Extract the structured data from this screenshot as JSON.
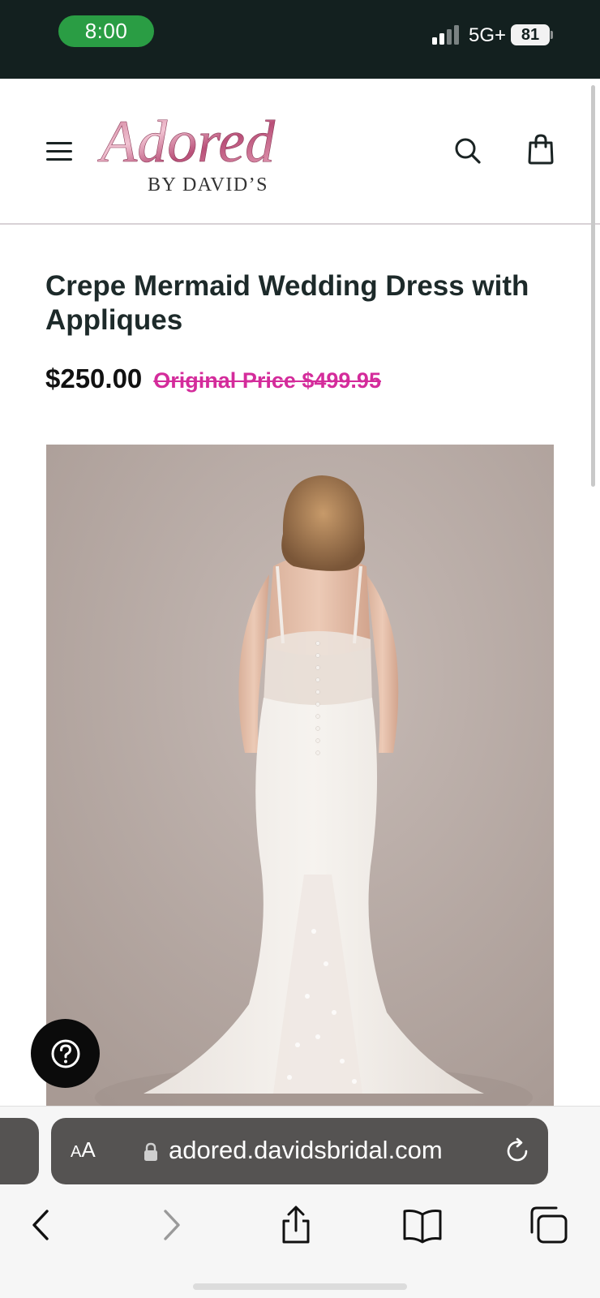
{
  "status_bar": {
    "time": "8:00",
    "network": "5G+",
    "battery": "81"
  },
  "header": {
    "logo_script": "Adored",
    "logo_subtitle": "BY DAVID’S",
    "icons": [
      "menu-icon",
      "search-icon",
      "shopping-bag-icon"
    ]
  },
  "product": {
    "title": "Crepe Mermaid Wedding Dress with Appliques",
    "sale_price": "$250.00",
    "original_price": "Original Price $499.95"
  },
  "help_button": {
    "icon": "question-mark-icon"
  },
  "browser": {
    "aa_label_small": "A",
    "aa_label_large": "A",
    "url": "adored.davidsbridal.com",
    "toolbar_icons": [
      "back-icon",
      "forward-icon",
      "share-icon",
      "bookmarks-icon",
      "tabs-icon"
    ]
  },
  "colors": {
    "status_bar_bg": "#13201f",
    "time_pill": "#2a9d44",
    "sale_accent": "#d42c9b",
    "title_text": "#1d2a2a"
  }
}
